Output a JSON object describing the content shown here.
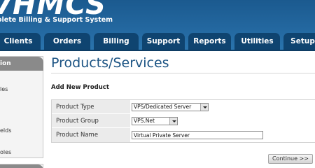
{
  "brand": {
    "logo": "VHMCS",
    "tagline": "olete Billing & Support System"
  },
  "nav": {
    "tabs": [
      "Clients",
      "Orders",
      "Billing",
      "Support",
      "Reports",
      "Utilities",
      "Setup"
    ]
  },
  "sidebar": {
    "header": "ion",
    "items": [
      "les",
      "elds",
      "oles"
    ]
  },
  "main": {
    "title": "Products/Services",
    "section_title": "Add New Product",
    "form": {
      "product_type": {
        "label": "Product Type",
        "value": "VPS/Dedicated Server"
      },
      "product_group": {
        "label": "Product Group",
        "value": "VPS.Net"
      },
      "product_name": {
        "label": "Product Name",
        "value": "Virtual Private Server"
      }
    },
    "continue_label": "Continue >>"
  },
  "colors": {
    "header": "#23679f",
    "tab": "#0f4470",
    "title": "#1b5383"
  }
}
